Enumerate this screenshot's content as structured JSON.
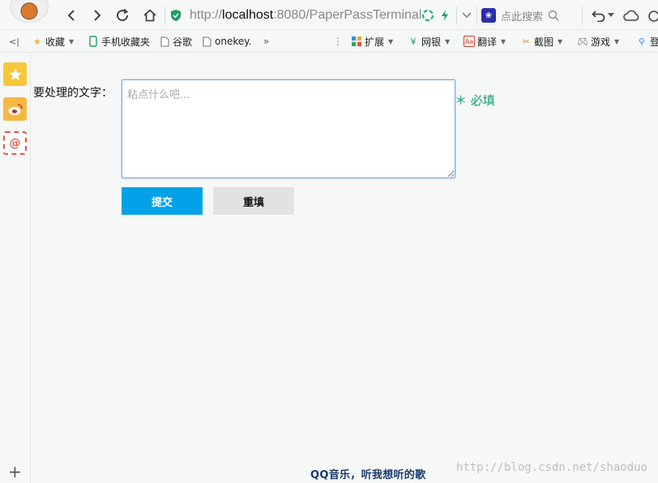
{
  "browser": {
    "url_prefix": "http://",
    "url_host": "localhost",
    "url_rest": ":8080/PaperPassTerminal",
    "search_placeholder": "点此搜索"
  },
  "bookmarks": {
    "back_label": "<|",
    "items": [
      "收藏",
      "手机收藏夹",
      "谷歌",
      "onekey.",
      "»"
    ],
    "tools": [
      "扩展",
      "网银",
      "翻译",
      "截图",
      "游戏",
      "登"
    ]
  },
  "form": {
    "label": "要处理的文字：",
    "placeholder": "粘点什么吧...",
    "required_text": "＊ 必填",
    "submit_label": "提交",
    "reset_label": "重填"
  },
  "footer": {
    "song": "QQ音乐，听我想听的歌",
    "watermark": "http://blog.csdn.net/shaoduo"
  },
  "colors": {
    "accent": "#03a2e8",
    "required": "#0e9a6c",
    "focus_border": "#7aa6dc"
  }
}
